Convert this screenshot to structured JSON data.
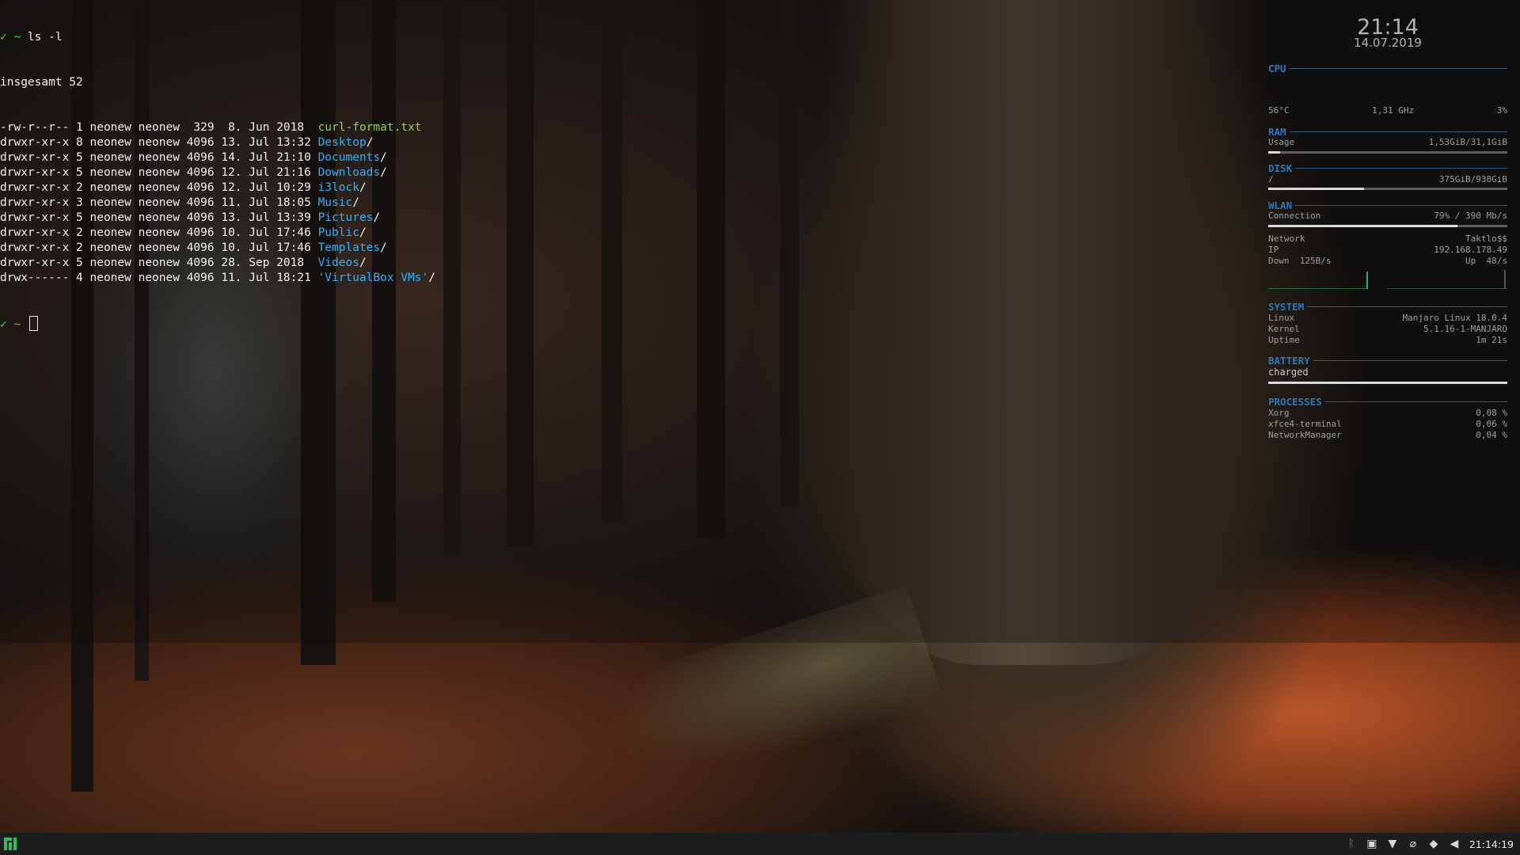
{
  "terminal": {
    "prompt_symbol": "✓ ~",
    "command": " ls -l",
    "total": "insgesamt 52",
    "entries": [
      {
        "meta": "-rw-r--r-- 1 neonew neonew  329  8. Jun 2018  ",
        "name": "curl-format.txt",
        "suffix": "",
        "kind": "file"
      },
      {
        "meta": "drwxr-xr-x 8 neonew neonew 4096 13. Jul 13:32 ",
        "name": "Desktop",
        "suffix": "/",
        "kind": "dir"
      },
      {
        "meta": "drwxr-xr-x 5 neonew neonew 4096 14. Jul 21:10 ",
        "name": "Documents",
        "suffix": "/",
        "kind": "dir"
      },
      {
        "meta": "drwxr-xr-x 5 neonew neonew 4096 12. Jul 21:16 ",
        "name": "Downloads",
        "suffix": "/",
        "kind": "dir"
      },
      {
        "meta": "drwxr-xr-x 2 neonew neonew 4096 12. Jul 10:29 ",
        "name": "i3lock",
        "suffix": "/",
        "kind": "dir"
      },
      {
        "meta": "drwxr-xr-x 3 neonew neonew 4096 11. Jul 18:05 ",
        "name": "Music",
        "suffix": "/",
        "kind": "dir"
      },
      {
        "meta": "drwxr-xr-x 5 neonew neonew 4096 13. Jul 13:39 ",
        "name": "Pictures",
        "suffix": "/",
        "kind": "dir"
      },
      {
        "meta": "drwxr-xr-x 2 neonew neonew 4096 10. Jul 17:46 ",
        "name": "Public",
        "suffix": "/",
        "kind": "dir"
      },
      {
        "meta": "drwxr-xr-x 2 neonew neonew 4096 10. Jul 17:46 ",
        "name": "Templates",
        "suffix": "/",
        "kind": "dir"
      },
      {
        "meta": "drwxr-xr-x 5 neonew neonew 4096 28. Sep 2018  ",
        "name": "Videos",
        "suffix": "/",
        "kind": "dir"
      },
      {
        "meta": "drwx------ 4 neonew neonew 4096 11. Jul 18:21 ",
        "name": "'VirtualBox VMs'",
        "suffix": "/",
        "kind": "dir"
      }
    ],
    "second_prompt": "✓ ~ "
  },
  "conky": {
    "time": "21:14",
    "date": "14.07.2019",
    "cpu": {
      "title": "CPU",
      "temp": "56°C",
      "freq": "1,31 GHz",
      "usage": "3%"
    },
    "ram": {
      "title": "RAM",
      "label": "Usage",
      "value": "1,53GiB/31,1GiB",
      "fill": 0.05
    },
    "disk": {
      "title": "DISK",
      "label": "/",
      "value": "375GiB/938GiB",
      "fill": 0.4
    },
    "wlan": {
      "title": "WLAN",
      "connection_label": "Connection",
      "connection_value": "79% / 390 Mb/s",
      "fill": 0.79,
      "network_label": "Network",
      "network_value": "Taktlo$$",
      "ip_label": "IP",
      "ip_value": "192.168.178.49",
      "down_label": "Down",
      "down_value": "125B/s",
      "up_label": "Up",
      "up_value": "48/s"
    },
    "system": {
      "title": "SYSTEM",
      "os_label": "Linux",
      "os_value": "Manjaro Linux 18.0.4",
      "kernel_label": "Kernel",
      "kernel_value": "5.1.16-1-MANJARO",
      "uptime_label": "Uptime",
      "uptime_value": "1m 21s"
    },
    "battery": {
      "title": "BATTERY",
      "status": "charged",
      "fill": 1.0
    },
    "processes": {
      "title": "PROCESSES",
      "items": [
        {
          "name": "Xorg",
          "value": "0,08 %"
        },
        {
          "name": "xfce4-terminal",
          "value": "0,06 %"
        },
        {
          "name": "NetworkManager",
          "value": "0,04 %"
        }
      ]
    }
  },
  "taskbar": {
    "clock": "21:14:19",
    "tray_icons": [
      "bluetooth-icon",
      "clipboard-icon",
      "wifi-icon",
      "paperclip-icon",
      "shield-icon",
      "volume-icon"
    ]
  }
}
